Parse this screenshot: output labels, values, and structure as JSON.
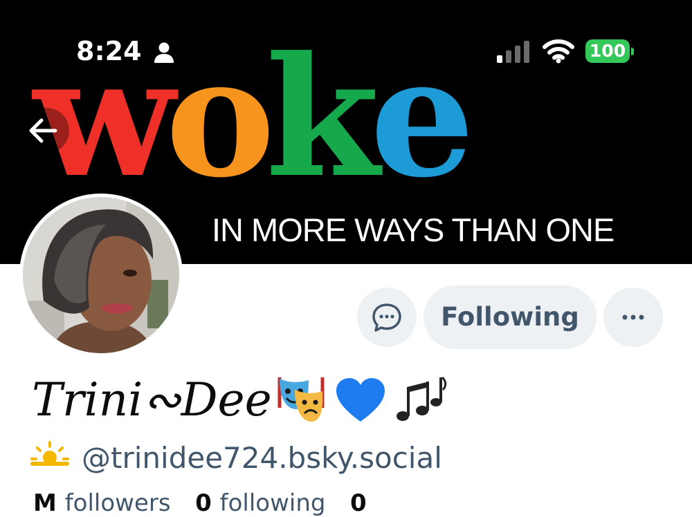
{
  "status_bar": {
    "time": "8:24",
    "battery": "100",
    "icons": [
      "person-icon",
      "cellular-signal-icon",
      "wifi-icon",
      "battery-icon"
    ]
  },
  "banner": {
    "word_letters": [
      "w",
      "o",
      "k",
      "e"
    ],
    "word_colors": [
      "#ef3029",
      "#f7941d",
      "#16a94b",
      "#1d9bd7"
    ],
    "tagline": "IN MORE WAYS THAN ONE"
  },
  "profile": {
    "display_name": "Trini∾Dee",
    "name_emojis": [
      "performing-arts-icon",
      "blue-heart-icon",
      "musical-notes-icon"
    ],
    "handle_icon": "sun-behind-cloud-icon",
    "handle": "@trinidee724.bsky.social",
    "stats": {
      "followers_count": "M",
      "followers_label": "followers",
      "following_count": "0",
      "following_label": "following",
      "posts_count": "0"
    }
  },
  "actions": {
    "following_label": "Following"
  },
  "colors": {
    "button_bg": "#eef1f4",
    "secondary_text": "#42566b",
    "battery_green": "#34c759"
  }
}
